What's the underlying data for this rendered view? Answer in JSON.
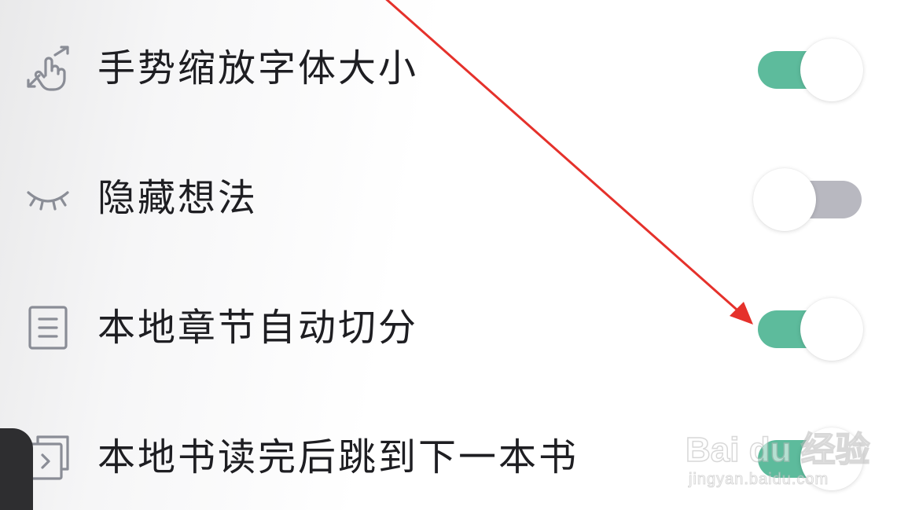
{
  "settings": [
    {
      "icon": "pinch-zoom-gesture-icon",
      "label": "手势缩放字体大小",
      "enabled": true
    },
    {
      "icon": "closed-eye-icon",
      "label": "隐藏想法",
      "enabled": false
    },
    {
      "icon": "chapter-list-icon",
      "label": "本地章节自动切分",
      "enabled": true
    },
    {
      "icon": "next-book-icon",
      "label": "本地书读完后跳到下一本书",
      "enabled": true
    }
  ],
  "watermark": {
    "brand": "Bai du 经验",
    "domain": "jingyan.baidu.com"
  },
  "colors": {
    "toggle_on": "#5dbb9c",
    "toggle_off": "#b8b8c0",
    "icon_stroke": "#8a8d96",
    "annotation_arrow": "#e5312b",
    "text": "#1e1e22"
  }
}
